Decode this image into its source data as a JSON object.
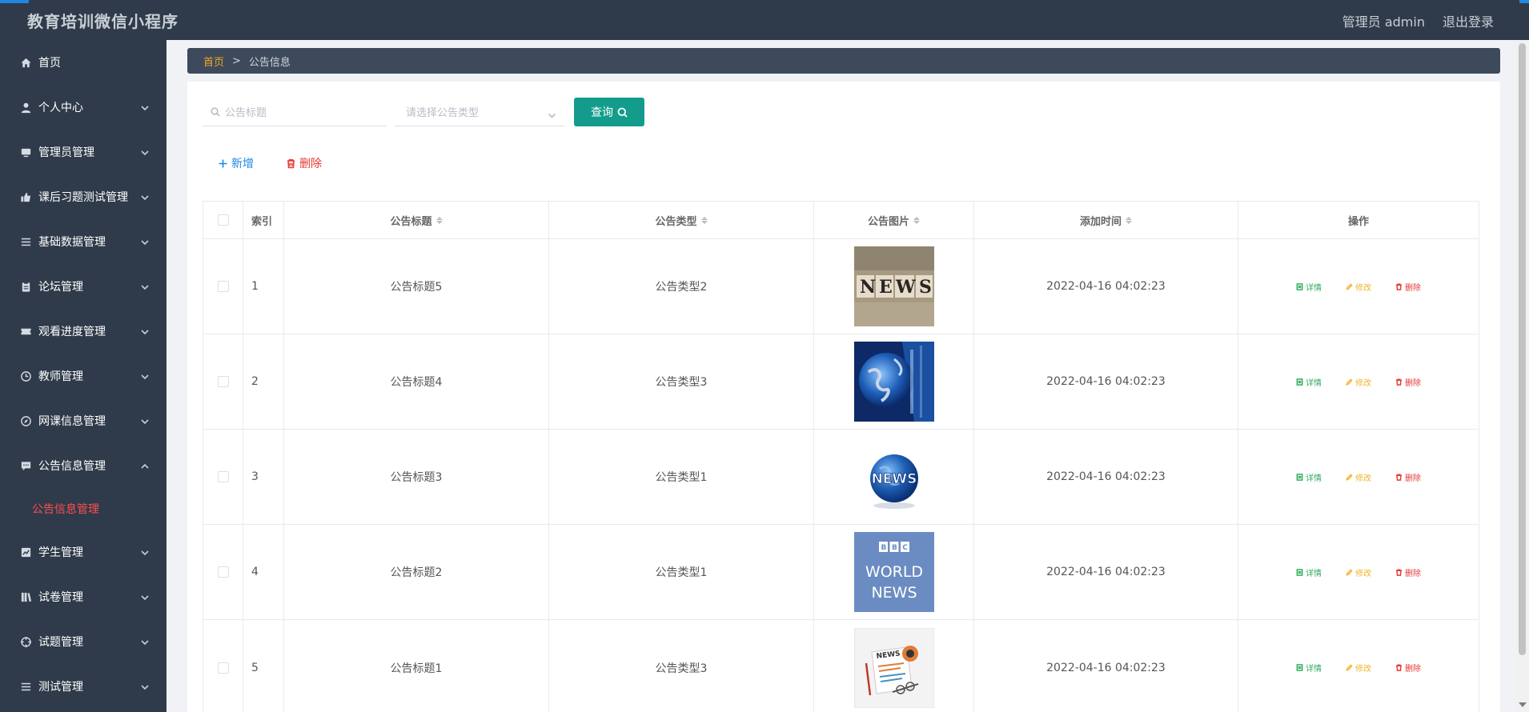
{
  "app": {
    "title": "教育培训微信小程序"
  },
  "header": {
    "user_label": "管理员 admin",
    "logout_label": "退出登录"
  },
  "sidebar": {
    "items": [
      {
        "label": "首页",
        "icon": "home-icon",
        "expandable": false
      },
      {
        "label": "个人中心",
        "icon": "user-icon",
        "expandable": true
      },
      {
        "label": "管理员管理",
        "icon": "monitor-icon",
        "expandable": true
      },
      {
        "label": "课后习题测试管理",
        "icon": "thumb-icon",
        "expandable": true
      },
      {
        "label": "基础数据管理",
        "icon": "list-icon",
        "expandable": true
      },
      {
        "label": "论坛管理",
        "icon": "clipboard-icon",
        "expandable": true
      },
      {
        "label": "观看进度管理",
        "icon": "ticket-icon",
        "expandable": true
      },
      {
        "label": "教师管理",
        "icon": "clock-icon",
        "expandable": true
      },
      {
        "label": "网课信息管理",
        "icon": "compass-icon",
        "expandable": true
      },
      {
        "label": "公告信息管理",
        "icon": "message-icon",
        "expandable": true,
        "open": true
      },
      {
        "label": "学生管理",
        "icon": "chart-icon",
        "expandable": true
      },
      {
        "label": "试卷管理",
        "icon": "book-icon",
        "expandable": true
      },
      {
        "label": "试题管理",
        "icon": "crosshair-icon",
        "expandable": true
      },
      {
        "label": "测试管理",
        "icon": "list-icon",
        "expandable": true
      }
    ],
    "active_sub": "公告信息管理"
  },
  "breadcrumb": {
    "home": "首页",
    "separator": ">",
    "current": "公告信息"
  },
  "filters": {
    "title_placeholder": "公告标题",
    "type_placeholder": "请选择公告类型",
    "query_label": "查询"
  },
  "actions": {
    "add_label": "新增",
    "delete_label": "删除"
  },
  "table": {
    "headers": {
      "index": "索引",
      "title": "公告标题",
      "type": "公告类型",
      "image": "公告图片",
      "time": "添加时间",
      "ops": "操作"
    },
    "op_labels": {
      "detail": "详情",
      "edit": "修改",
      "remove": "删除"
    },
    "rows": [
      {
        "index": "1",
        "title": "公告标题5",
        "type": "公告类型2",
        "image": "news-tiles-image",
        "time": "2022-04-16 04:02:23"
      },
      {
        "index": "2",
        "title": "公告标题4",
        "type": "公告类型3",
        "image": "globe-news-image",
        "time": "2022-04-16 04:02:23"
      },
      {
        "index": "3",
        "title": "公告标题3",
        "type": "公告类型1",
        "image": "news-globe-logo-image",
        "time": "2022-04-16 04:02:23"
      },
      {
        "index": "4",
        "title": "公告标题2",
        "type": "公告类型1",
        "image": "bbc-world-news-image",
        "time": "2022-04-16 04:02:23"
      },
      {
        "index": "5",
        "title": "公告标题1",
        "type": "公告类型3",
        "image": "newspaper-illustration-image",
        "time": "2022-04-16 04:02:23"
      }
    ]
  },
  "colors": {
    "sidebar_bg": "#2f3b4a",
    "active_sub": "#ff4d4f",
    "query_button": "#139c8c",
    "breadcrumb_home": "#f5a623",
    "add": "#1e88e5",
    "delete": "#e53935",
    "detail": "#2eaa5c",
    "edit": "#f0b429"
  }
}
